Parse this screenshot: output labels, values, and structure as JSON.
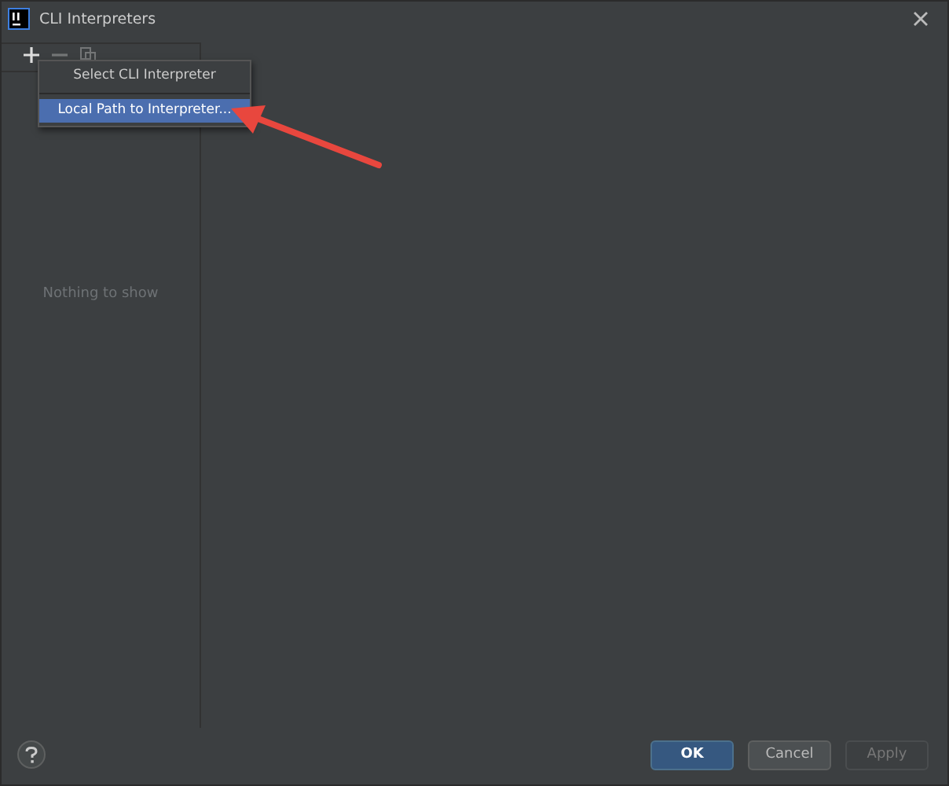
{
  "window": {
    "title": "CLI Interpreters"
  },
  "toolbar": [
    {
      "kind": "add",
      "disabled": false
    },
    {
      "kind": "remove",
      "disabled": true
    },
    {
      "kind": "copy",
      "disabled": true
    }
  ],
  "menu": [
    {
      "label": "Select CLI Interpreter",
      "selected": false
    },
    {
      "label": "Local Path to Interpreter...",
      "selected": true
    }
  ],
  "list": {
    "empty_text": "Nothing to show"
  },
  "buttons": [
    {
      "label": "OK",
      "default": true,
      "disabled": false
    },
    {
      "label": "Cancel",
      "default": false,
      "disabled": false
    },
    {
      "label": "Apply",
      "default": false,
      "disabled": true
    }
  ]
}
